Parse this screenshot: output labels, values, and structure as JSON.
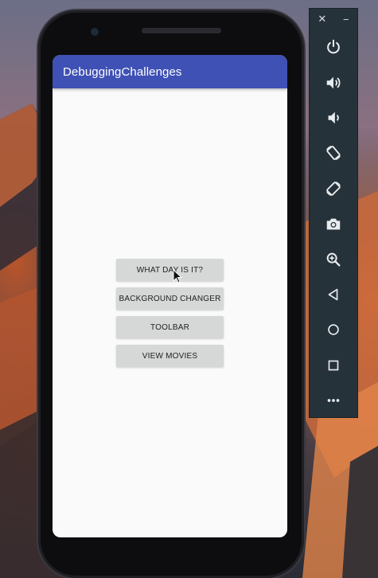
{
  "app": {
    "title": "DebuggingChallenges"
  },
  "buttons": [
    {
      "label": "WHAT DAY IS IT?"
    },
    {
      "label": "BACKGROUND CHANGER"
    },
    {
      "label": "TOOLBAR"
    },
    {
      "label": "VIEW MOVIES"
    }
  ],
  "emulator_panel": {
    "window_controls": [
      "close-icon",
      "minimize-icon"
    ],
    "close_glyph": "✕",
    "minimize_glyph": "−",
    "tools": [
      "power-icon",
      "volume-up-icon",
      "volume-down-icon",
      "rotate-left-icon",
      "rotate-right-icon",
      "camera-icon",
      "zoom-icon",
      "back-icon",
      "home-icon",
      "overview-icon",
      "more-icon"
    ]
  },
  "colors": {
    "app_bar": "#3f51b5",
    "screen_bg": "#fafafa",
    "button_bg": "#d6d7d7",
    "panel_bg": "#26323a"
  }
}
